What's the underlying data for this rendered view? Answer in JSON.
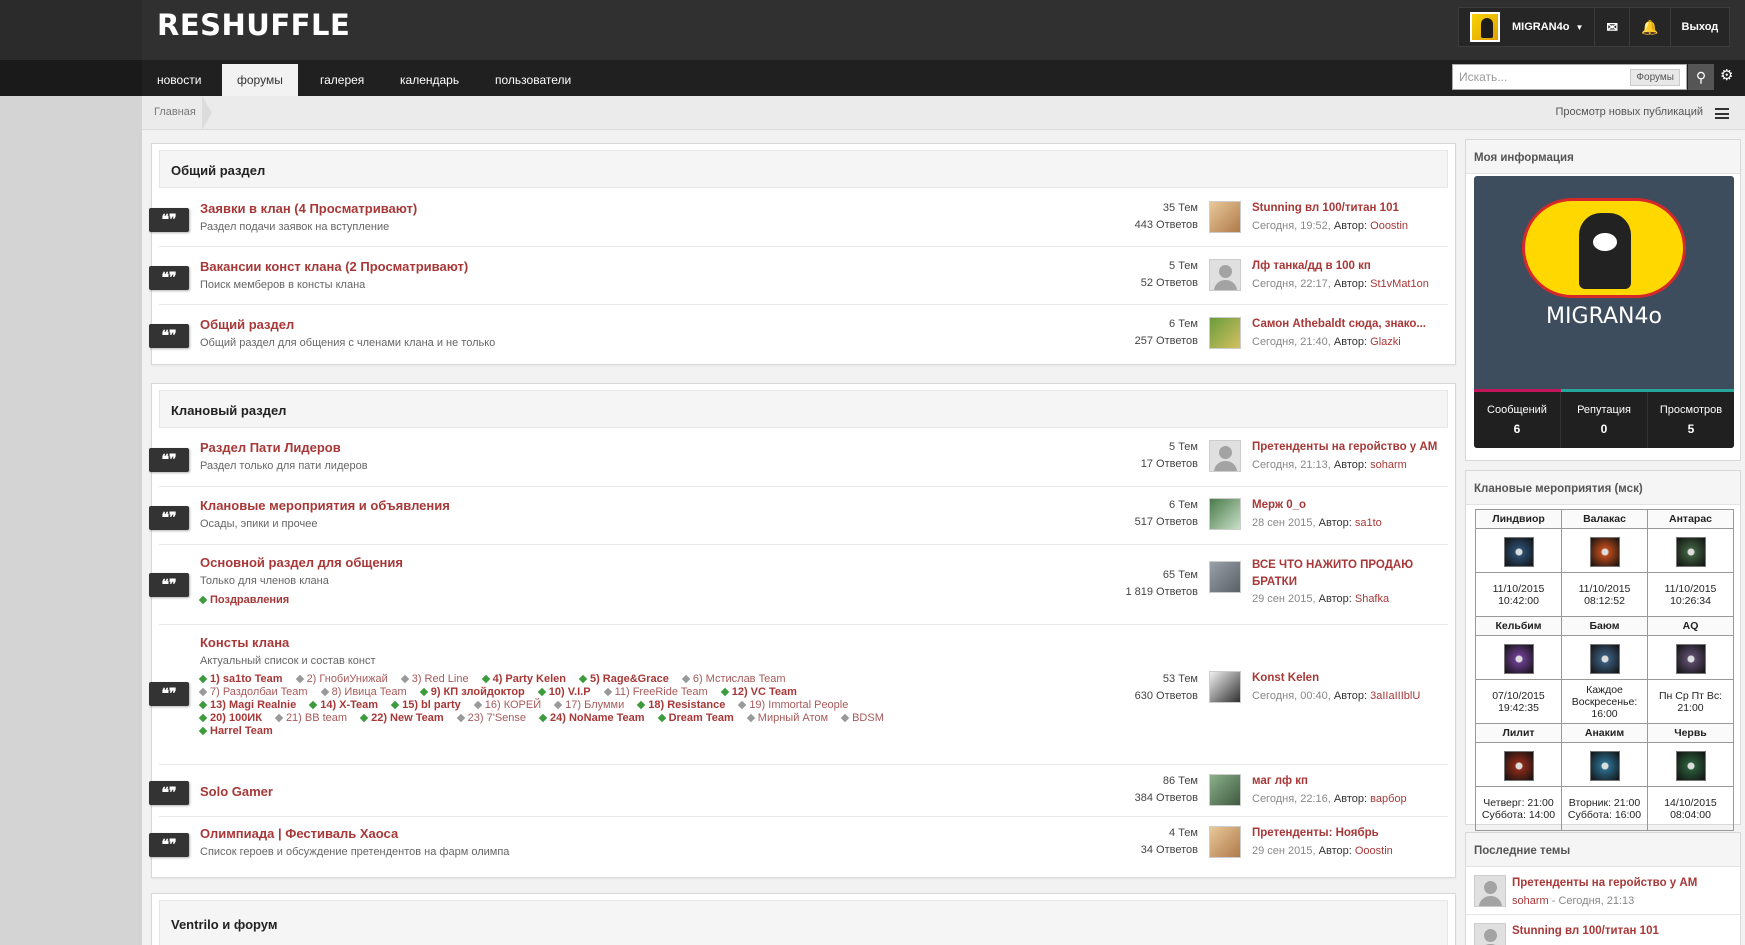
{
  "site": {
    "logo": "RESHUFFLE"
  },
  "user": {
    "name": "MIGRAN4o",
    "logout": "Выход"
  },
  "nav": {
    "tabs": [
      "новости",
      "форумы",
      "галерея",
      "календарь",
      "пользователи"
    ],
    "active": "форумы"
  },
  "search": {
    "placeholder": "Искать...",
    "scope": "Форумы"
  },
  "breadcrumb": {
    "home": "Главная",
    "new_posts": "Просмотр новых публикаций"
  },
  "sections": [
    {
      "title": "Общий раздел",
      "forums": [
        {
          "title": "Заявки в клан (4 Просматривают)",
          "desc": "Раздел подачи заявок на вступление",
          "topics": "35 Тем",
          "replies": "443 Ответов",
          "last_title": "Stunning вл 100/титан 101",
          "last_time": "Сегодня, 19:52",
          "author_label": "Автор:",
          "last_author": "Ooostin"
        },
        {
          "title": "Вакансии конст клана (2 Просматривают)",
          "desc": "Поиск мемберов в консты клана",
          "topics": "5 Тем",
          "replies": "52 Ответов",
          "last_title": "Лф танка/дд в 100 кп",
          "last_time": "Сегодня, 22:17",
          "author_label": "Автор:",
          "last_author": "St1vMat1on"
        },
        {
          "title": "Общий раздел",
          "desc": "Общий раздел для общения с членами клана и не только",
          "topics": "6 Тем",
          "replies": "257 Ответов",
          "last_title": "Самон Athebaldt сюда, знако...",
          "last_time": "Сегодня, 21:40",
          "author_label": "Автор:",
          "last_author": "Glazki"
        }
      ]
    },
    {
      "title": "Клановый раздел",
      "forums": [
        {
          "title": "Раздел Пати Лидеров",
          "desc": "Раздел только для пати лидеров",
          "topics": "5 Тем",
          "replies": "17 Ответов",
          "last_title": "Претенденты на геройство у АМ",
          "last_time": "Сегодня, 21:13",
          "author_label": "Автор:",
          "last_author": "soharm"
        },
        {
          "title": "Клановые мероприятия и объявления",
          "desc": "Осады, эпики и прочее",
          "topics": "6 Тем",
          "replies": "517 Ответов",
          "last_title": "Мерж 0_о",
          "last_time": "28 сен 2015",
          "author_label": "Автор:",
          "last_author": "sa1to"
        },
        {
          "title": "Основной раздел для общения",
          "desc": "Только для членов клана",
          "subforum": "Поздравления",
          "topics": "65 Тем",
          "replies": "1 819 Ответов",
          "last_title": "ВСЕ ЧТО НАЖИТО ПРОДАЮ",
          "last_title2": "БРАТКИ",
          "last_time": "29 сен 2015",
          "author_label": "Автор:",
          "last_author": "Shafka"
        },
        {
          "title": "Консты клана",
          "desc": "Актуальный список и состав конст",
          "topics": "53 Тем",
          "replies": "630 Ответов",
          "last_title": "Konst Kelen",
          "last_time": "Сегодня, 00:40",
          "author_label": "Автор:",
          "last_author": "3aIIaIIIblU",
          "subforums": [
            {
              "t": "1) sa1to Team",
              "n": true
            },
            {
              "t": "2) ГнобиУнижай",
              "n": false
            },
            {
              "t": "3) Red Line",
              "n": false
            },
            {
              "t": "4) Party Kelen",
              "n": true
            },
            {
              "t": "5) Rage&Grace",
              "n": true
            },
            {
              "t": "6) Мстислав Team",
              "n": false
            },
            {
              "t": "7) Раздолбаи Team",
              "n": false
            },
            {
              "t": "8) Ивица Team",
              "n": false
            },
            {
              "t": "9) КП злойдоктор",
              "n": true
            },
            {
              "t": "10) V.I.P",
              "n": true
            },
            {
              "t": "11) FreeRide Team",
              "n": false
            },
            {
              "t": "12) VC Team",
              "n": true
            },
            {
              "t": "13) Magi Realnie",
              "n": true
            },
            {
              "t": "14) X-Team",
              "n": true
            },
            {
              "t": "15) bl party",
              "n": true
            },
            {
              "t": "16) КОРЕЙ",
              "n": false
            },
            {
              "t": "17) Блумми",
              "n": false
            },
            {
              "t": "18) Resistance",
              "n": true
            },
            {
              "t": "19) Immortal People",
              "n": false
            },
            {
              "t": "20) 100ИК",
              "n": true
            },
            {
              "t": "21) BB team",
              "n": false
            },
            {
              "t": "22) New Team",
              "n": true
            },
            {
              "t": "23) 7'Sense",
              "n": false
            },
            {
              "t": "24) NoName Team",
              "n": true
            },
            {
              "t": "Dream Team",
              "n": true
            },
            {
              "t": "Мирный Атом",
              "n": false
            },
            {
              "t": "BDSM",
              "n": false
            },
            {
              "t": "Harrel Team",
              "n": true
            }
          ]
        },
        {
          "title": "Solo Gamer",
          "desc": "",
          "topics": "86 Тем",
          "replies": "384 Ответов",
          "last_title": "маг лф кп",
          "last_time": "Сегодня, 22:16",
          "author_label": "Автор:",
          "last_author": "варбор"
        },
        {
          "title": "Олимпиада | Фестиваль Хаоса",
          "desc": "Список героев и обсуждение претендентов на фарм олимпа",
          "topics": "4 Тем",
          "replies": "34 Ответов",
          "last_title": "Претенденты: Ноябрь",
          "last_time": "29 сен 2015",
          "author_label": "Автор:",
          "last_author": "Ooostin"
        }
      ]
    },
    {
      "title": "Ventrilo и форум",
      "forums": []
    }
  ],
  "sidebar": {
    "myinfo": {
      "title": "Моя информация",
      "name": "MIGRAN4o",
      "stats": [
        {
          "label": "Сообщений",
          "value": "6"
        },
        {
          "label": "Репутация",
          "value": "0"
        },
        {
          "label": "Просмотров",
          "value": "5"
        }
      ]
    },
    "events": {
      "title": "Клановые мероприятия (мск)",
      "rows": [
        [
          {
            "name": "Линдвиор",
            "time": "11/10/2015\n10:42:00",
            "color": "#2b4d6e"
          },
          {
            "name": "Валакас",
            "time": "11/10/2015\n08:12:52",
            "color": "#b84a1a"
          },
          {
            "name": "Антарас",
            "time": "11/10/2015\n10:26:34",
            "color": "#3d5c3d"
          }
        ],
        [
          {
            "name": "Кельбим",
            "time": "07/10/2015\n19:42:35",
            "color": "#6a3d8c"
          },
          {
            "name": "Баюм",
            "time": "Каждое\nВоскресенье:\n16:00",
            "color": "#3a5a7a"
          },
          {
            "name": "AQ",
            "time": "Пн Ср Пт Вс:\n21:00",
            "color": "#5a4a6a"
          }
        ],
        [
          {
            "name": "Лилит",
            "time": "Четверг: 21:00\nСуббота: 14:00",
            "color": "#8a2a1a"
          },
          {
            "name": "Анаким",
            "time": "Вторник: 21:00\nСуббота: 16:00",
            "color": "#2a6a8a"
          },
          {
            "name": "Червь",
            "time": "14/10/2015\n08:04:00",
            "color": "#2a5a3a"
          }
        ]
      ]
    },
    "recent": {
      "title": "Последние темы",
      "items": [
        {
          "title": "Претенденты на геройство у АМ",
          "author": "soharm",
          "sep": " - ",
          "time": "Сегодня, 21:13"
        },
        {
          "title": "Stunning вл 100/титан 101",
          "author": "",
          "sep": "",
          "time": ""
        }
      ]
    }
  },
  "colors": {
    "accent": "#a83838",
    "header": "#303030",
    "nav": "#202020",
    "green": "#3c9b3c"
  }
}
